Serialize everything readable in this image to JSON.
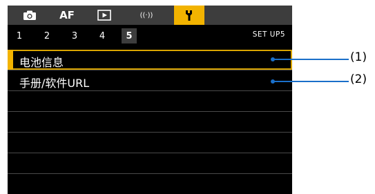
{
  "tabs": [
    {
      "id": "shooting",
      "icon": "camera-icon",
      "active": false
    },
    {
      "id": "af",
      "label": "AF",
      "active": false
    },
    {
      "id": "playback",
      "icon": "play-icon",
      "active": false
    },
    {
      "id": "wireless",
      "label": "((·))",
      "icon": "wireless-icon",
      "active": false
    },
    {
      "id": "setup",
      "icon": "wrench-icon",
      "active": true
    }
  ],
  "pages": [
    "1",
    "2",
    "3",
    "4",
    "5"
  ],
  "active_page": "5",
  "page_label": "SET UP5",
  "menu": {
    "items": [
      {
        "label": "电池信息",
        "selected": true
      },
      {
        "label": "手册/软件URL",
        "selected": false
      },
      {
        "label": ""
      },
      {
        "label": ""
      },
      {
        "label": ""
      },
      {
        "label": ""
      },
      {
        "label": ""
      }
    ]
  },
  "callouts": [
    "(1)",
    "(2)"
  ],
  "colors": {
    "accent": "#f2b300",
    "tab_bar": "#3d3d3d",
    "callout": "#1a6fc9"
  }
}
